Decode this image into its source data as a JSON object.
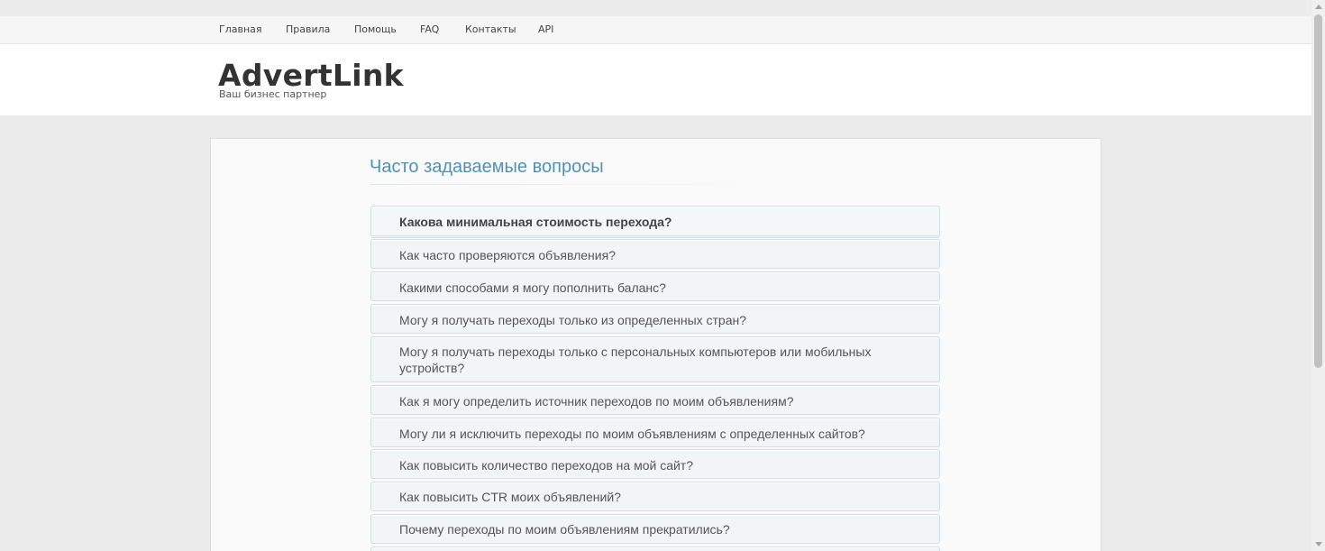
{
  "nav": {
    "items": [
      {
        "label": "Главная"
      },
      {
        "label": "Правила"
      },
      {
        "label": "Помощь"
      },
      {
        "label": "FAQ"
      },
      {
        "label": "Контакты"
      },
      {
        "label": "API"
      }
    ]
  },
  "header": {
    "logo": "AdvertLink",
    "tagline": "Ваш бизнес партнер"
  },
  "faq": {
    "title": "Часто задаваемые вопросы",
    "items": [
      {
        "question": "Какова минимальная стоимость перехода?",
        "expanded": true
      },
      {
        "question": "Как часто проверяются объявления?"
      },
      {
        "question": "Какими способами я могу пополнить баланс?"
      },
      {
        "question": "Могу я получать переходы только из определенных стран?"
      },
      {
        "question": "Могу я получать переходы только с персональных компьютеров или мобильных устройств?"
      },
      {
        "question": "Как я могу определить источник переходов по моим объявлениям?"
      },
      {
        "question": "Могу ли я исключить переходы по моим объявлениям с определенных сайтов?"
      },
      {
        "question": "Как повысить количество переходов на мой сайт?"
      },
      {
        "question": "Как повысить CTR моих объявлений?"
      },
      {
        "question": "Почему переходы по моим объявлениям прекратились?"
      }
    ]
  }
}
